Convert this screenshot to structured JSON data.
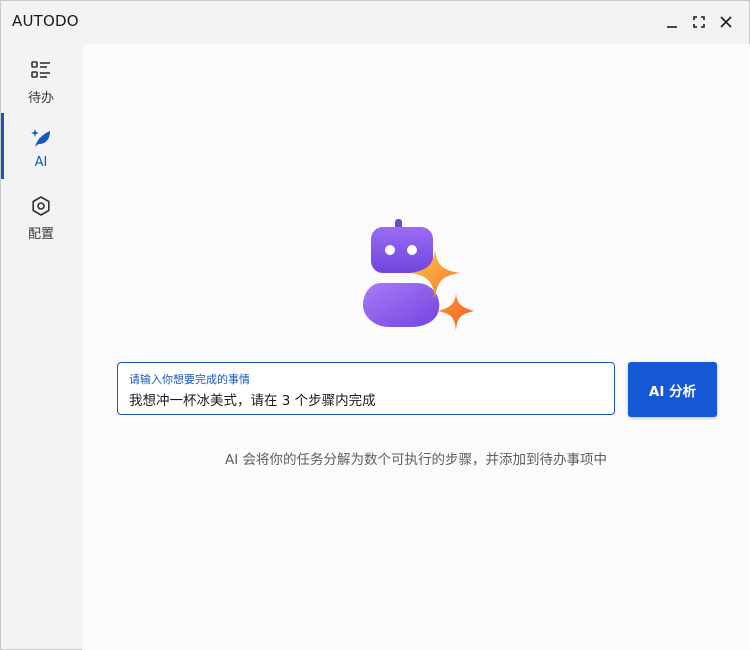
{
  "window": {
    "title": "AUTODO",
    "controls": {
      "minimize": "minimize-icon",
      "maximize": "maximize-icon",
      "close": "close-icon"
    }
  },
  "sidebar": {
    "items": [
      {
        "label": "待办",
        "icon": "todo-list-icon",
        "active": false
      },
      {
        "label": "AI",
        "icon": "ai-sparkle-leaf-icon",
        "active": true
      },
      {
        "label": "配置",
        "icon": "settings-gear-icon",
        "active": false
      }
    ]
  },
  "main": {
    "illustration": "robot-sparkle-icon",
    "input": {
      "label": "请输入你想要完成的事情",
      "value": "我想冲一杯冰美式，请在 3 个步骤内完成"
    },
    "analyze_button": "AI 分析",
    "hint": "AI 会将你的任务分解为数个可执行的步骤，并添加到待办事项中"
  },
  "colors": {
    "accent": "#1a56b8",
    "button": "#1557d4",
    "robot_purple": "#8b5cf6",
    "sparkle_orange": "#f97316"
  }
}
